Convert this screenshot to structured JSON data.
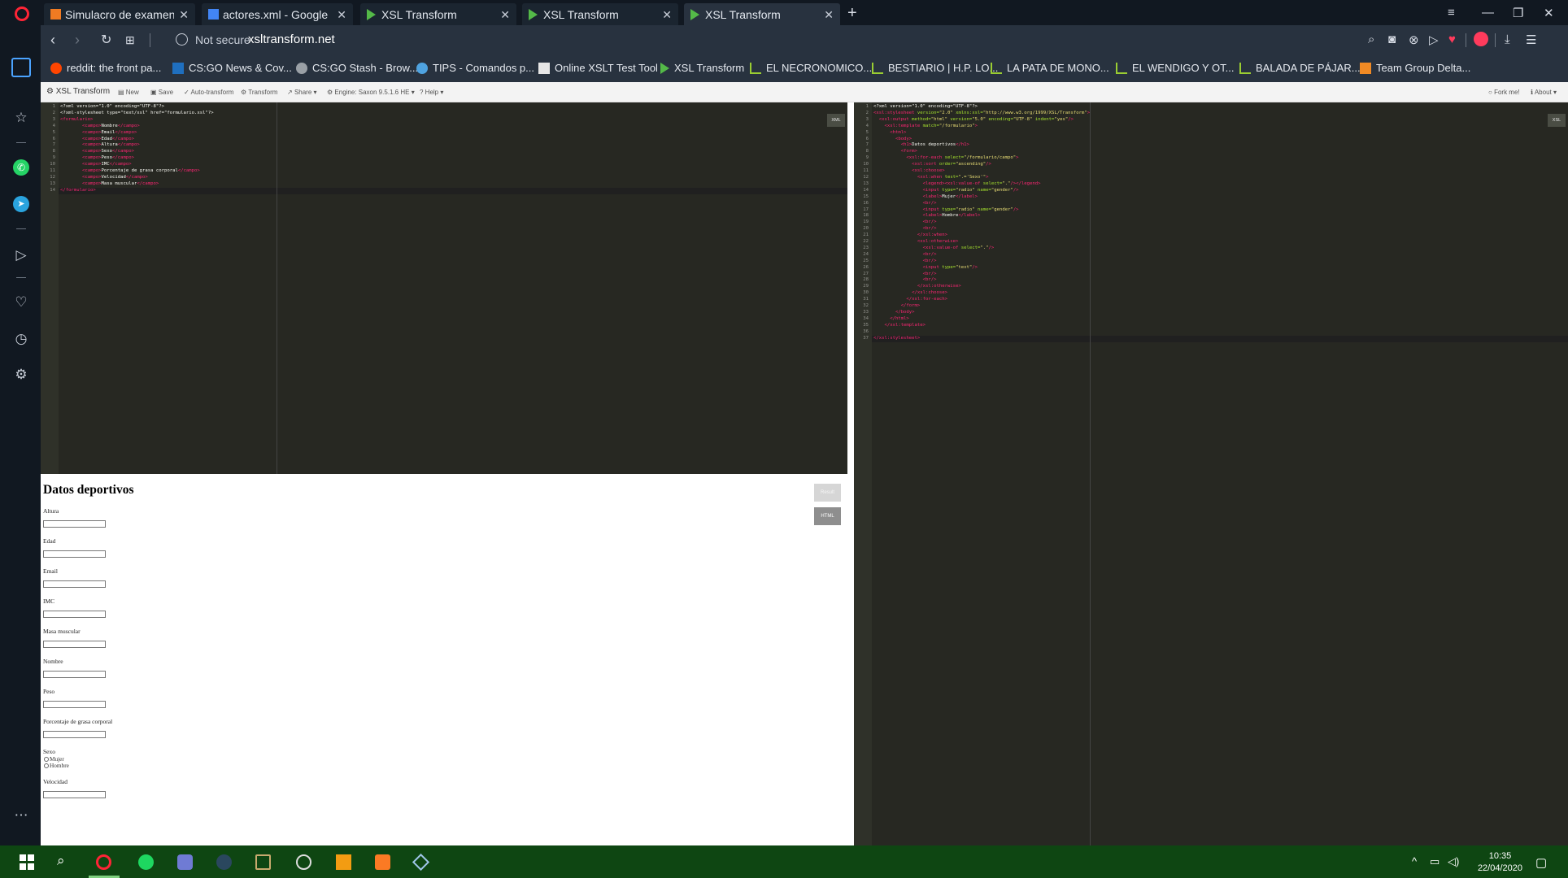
{
  "browser": {
    "tabs": [
      {
        "label": "Simulacro de examen de X",
        "active": false,
        "color": "#f07b22"
      },
      {
        "label": "actores.xml - Google Drive",
        "active": false,
        "color": "#4285f4"
      },
      {
        "label": "XSL Transform",
        "active": false,
        "color": "#54b948"
      },
      {
        "label": "XSL Transform",
        "active": false,
        "color": "#54b948"
      },
      {
        "label": "XSL Transform",
        "active": true,
        "color": "#54b948"
      }
    ],
    "not_secure": "Not secure",
    "url": "xsltransform.net",
    "bookmarks": [
      {
        "label": "reddit: the front pa...",
        "color": "#ff4500"
      },
      {
        "label": "CS:GO News & Cov...",
        "color": "#1f6fbf"
      },
      {
        "label": "CS:GO Stash - Brow...",
        "color": "#9aa0a6"
      },
      {
        "label": "TIPS - Comandos p...",
        "color": "#4fa3e0"
      },
      {
        "label": "Online XSLT Test Tool",
        "color": "#e6e6e6"
      },
      {
        "label": "XSL Transform",
        "color": "#54b948"
      },
      {
        "label": "EL NECRONOMICO...",
        "color": "#9acd32"
      },
      {
        "label": "BESTIARIO | H.P. LO...",
        "color": "#9acd32"
      },
      {
        "label": "LA PATA DE MONO...",
        "color": "#9acd32"
      },
      {
        "label": "EL WENDIGO Y OT...",
        "color": "#9acd32"
      },
      {
        "label": "BALADA DE PÁJAR...",
        "color": "#9acd32"
      },
      {
        "label": "Team Group Delta...",
        "color": "#f08a24"
      }
    ]
  },
  "toolbar": {
    "brand": "XSL Transform",
    "new": "New",
    "save": "Save",
    "auto_transform": "Auto-transform",
    "transform": "Transform",
    "share": "Share ▾",
    "engine": "Engine: Saxon 9.5.1.6 HE ▾",
    "help": "Help ▾",
    "fork": "Fork me!",
    "about": "About ▾"
  },
  "editors": {
    "xml_badge": "XML",
    "xsl_badge": "XSL"
  },
  "output": {
    "title": "Datos deportivos",
    "fields": [
      "Altura",
      "Edad",
      "Email",
      "IMC",
      "Masa muscular",
      "Nombre",
      "Peso",
      "Porcentaje de grasa corporal",
      "Sexo",
      "Velocidad"
    ],
    "radio_options": [
      "Mujer",
      "Hombre"
    ],
    "buttons": {
      "result": "Result",
      "html": "HTML"
    }
  },
  "taskbar": {
    "time": "10:35",
    "date": "22/04/2020"
  }
}
